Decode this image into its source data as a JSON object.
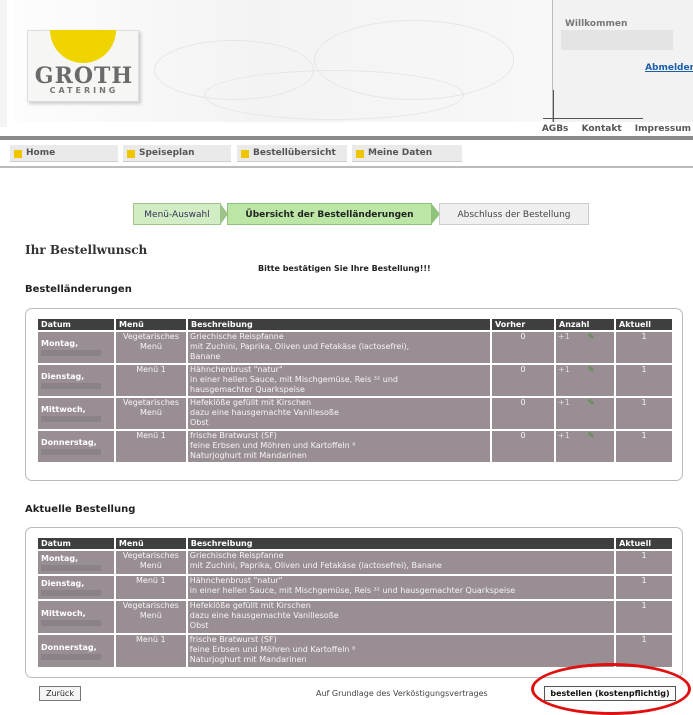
{
  "header": {
    "logo_line1": "GROTH",
    "logo_line2": "CATERING",
    "welcome": "Willkommen",
    "logout": "Abmelden",
    "links": [
      "AGBs",
      "Kontakt",
      "Impressum"
    ]
  },
  "nav": {
    "items": [
      "Home",
      "Speiseplan",
      "Bestellübersicht",
      "Meine Daten"
    ]
  },
  "steps": [
    "Menü-Auswahl",
    "Übersicht der Bestelländerungen",
    "Abschluss der Bestellung"
  ],
  "page": {
    "title": "Ihr Bestellwunsch",
    "confirm": "Bitte bestätigen Sie Ihre Bestellung!!!",
    "changes_heading": "Bestelländerungen",
    "current_heading": "Aktuelle Bestellung"
  },
  "changes": {
    "headers": [
      "Datum",
      "Menü",
      "Beschreibung",
      "Vorher",
      "Anzahl",
      "Aktuell"
    ],
    "rows": [
      {
        "day": "Montag,",
        "menu": "Vegetarisches Menü",
        "desc": [
          "Griechische Reispfanne",
          "mit Zuchini, Paprika, Oliven und Fetakäse (lactosefrei),",
          "Banane"
        ],
        "before": "0",
        "qty": "+1",
        "current": "1"
      },
      {
        "day": "Dienstag,",
        "menu": "Menü 1",
        "desc": [
          "Hähnchenbrust \"natur\"",
          "in einer hellen Sauce, mit Mischgemüse, Reis ³² und",
          "hausgemachter Quarkspeise"
        ],
        "before": "0",
        "qty": "+1",
        "current": "1"
      },
      {
        "day": "Mittwoch,",
        "menu": "Vegetarisches Menü",
        "desc": [
          "Hefeklöße gefüllt mit Kirschen",
          "dazu eine hausgemachte Vanillesoße",
          "Obst"
        ],
        "before": "0",
        "qty": "+1",
        "current": "1"
      },
      {
        "day": "Donnerstag,",
        "menu": "Menü 1",
        "desc": [
          "frische Bratwurst (SF)",
          "feine Erbsen und Möhren und Kartoffeln ⁸",
          "Naturjoghurt mit Mandarinen"
        ],
        "before": "0",
        "qty": "+1",
        "current": "1"
      }
    ]
  },
  "current": {
    "headers": [
      "Datum",
      "Menü",
      "Beschreibung",
      "Aktuell"
    ],
    "rows": [
      {
        "day": "Montag,",
        "menu": "Vegetarisches Menü",
        "desc": [
          "Griechische Reispfanne",
          "mit Zuchini, Paprika, Oliven und Fetakäse (lactosefrei), Banane"
        ],
        "current": "1"
      },
      {
        "day": "Dienstag,",
        "menu": "Menü 1",
        "desc": [
          "Hähnchenbrust \"natur\"",
          "in einer hellen Sauce, mit Mischgemüse, Reis ³² und hausgemachter Quarkspeise"
        ],
        "current": "1"
      },
      {
        "day": "Mittwoch,",
        "menu": "Vegetarisches Menü",
        "desc": [
          "Hefeklöße gefüllt mit Kirschen",
          "dazu eine hausgemachte Vanillesoße",
          "Obst"
        ],
        "current": "1"
      },
      {
        "day": "Donnerstag,",
        "menu": "Menü 1",
        "desc": [
          "frische Bratwurst (SF)",
          "feine Erbsen und Möhren und Kartoffeln ⁸",
          "Naturjoghurt mit Mandarinen"
        ],
        "current": "1"
      }
    ]
  },
  "footer": {
    "back": "Zurück",
    "basis": "Auf Grundlage des Verköstigungsvertrages",
    "order": "bestellen (kostenpflichtig)"
  },
  "colors": {
    "accent": "#f0c400",
    "row": "#9a8e95",
    "header": "#3f3f3f",
    "highlight": "#e01010"
  }
}
